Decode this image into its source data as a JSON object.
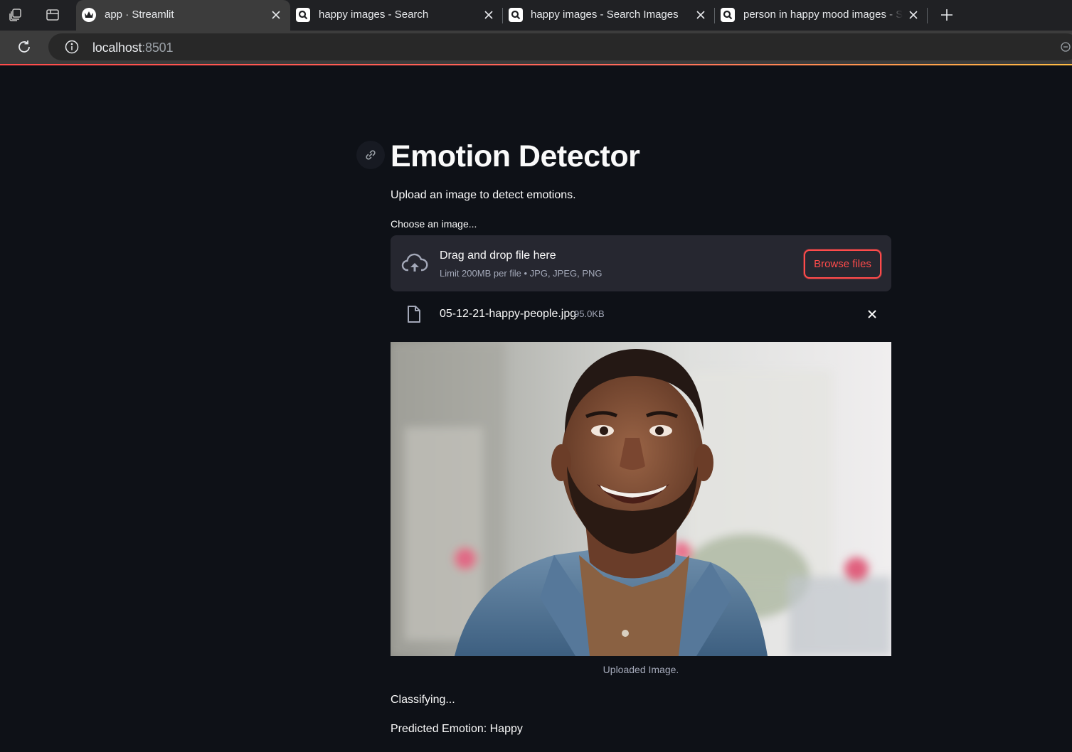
{
  "browser": {
    "tabs": [
      {
        "title": "app · Streamlit",
        "favicon": "streamlit-crown-icon",
        "active": true
      },
      {
        "title": "happy images - Search",
        "favicon": "search-favicon-icon",
        "active": false
      },
      {
        "title": "happy images - Search Images",
        "favicon": "search-favicon-icon",
        "active": false
      },
      {
        "title": "person in happy mood images - S",
        "favicon": "search-favicon-icon",
        "active": false
      }
    ],
    "url_host": "localhost",
    "url_port": ":8501",
    "icons": [
      "workspaces-icon",
      "tab-actions-icon",
      "new-tab-icon",
      "reload-icon",
      "site-info-icon",
      "zoom-icon"
    ]
  },
  "app": {
    "title": "Emotion Detector",
    "subtitle": "Upload an image to detect emotions.",
    "uploader": {
      "label": "Choose an image...",
      "drop_text": "Drag and drop file here",
      "limit_text": "Limit 200MB per file • JPG, JPEG, PNG",
      "browse_label": "Browse files",
      "file_name": "05-12-21-happy-people.jpg",
      "file_size": "95.0KB"
    },
    "image_caption": "Uploaded Image.",
    "status_text": "Classifying...",
    "result_text": "Predicted Emotion: Happy"
  },
  "colors": {
    "background": "#0e1117",
    "accent": "#ff4b4b",
    "dropzone": "#262730",
    "text": "#fafafa",
    "muted": "#a3a8b8"
  }
}
